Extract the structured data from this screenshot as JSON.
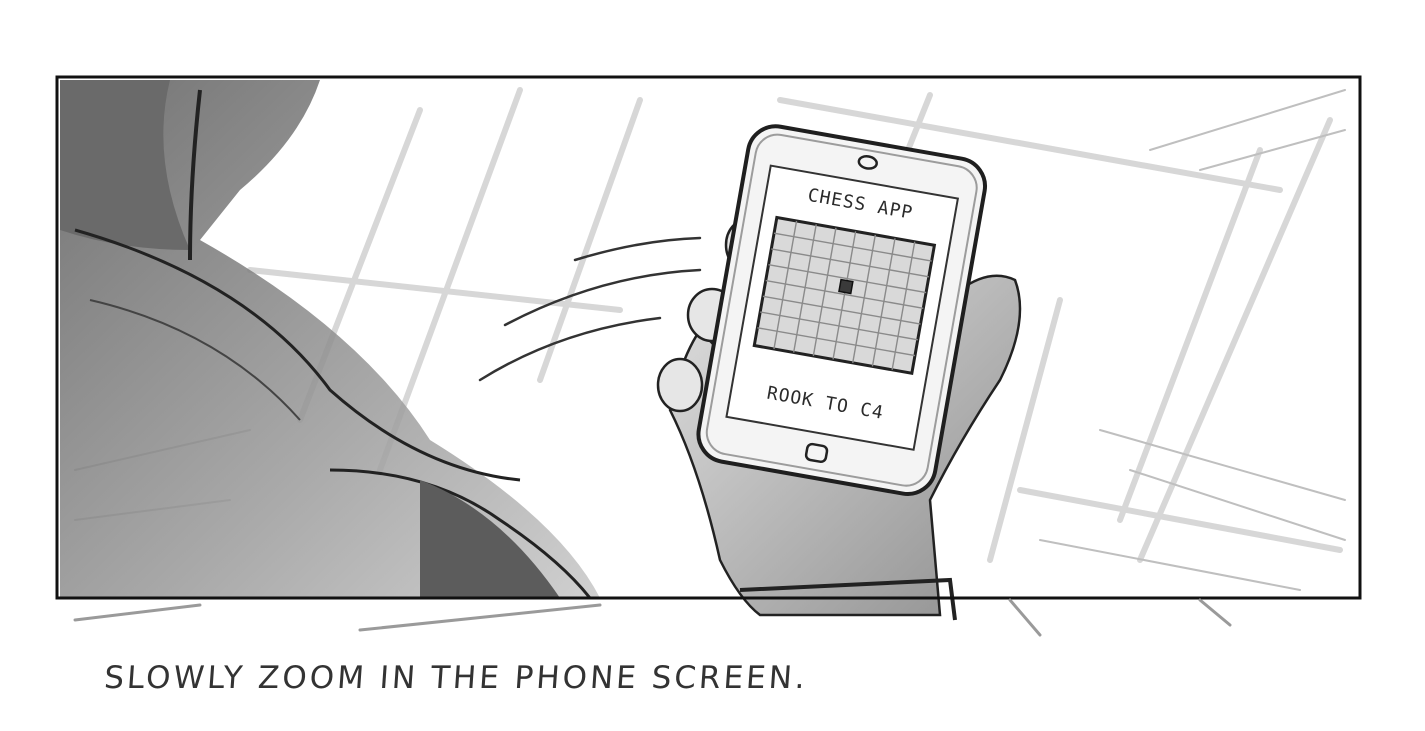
{
  "frame": {
    "screen_title": "CHESS APP",
    "screen_status": "ROOK TO C4"
  },
  "caption": "SLOWLY ZOOM IN THE PHONE SCREEN.",
  "colors": {
    "ink": "#222222",
    "shadow": "#8a8a8a",
    "light_shade": "#cfcfcf",
    "paper": "#ffffff"
  }
}
